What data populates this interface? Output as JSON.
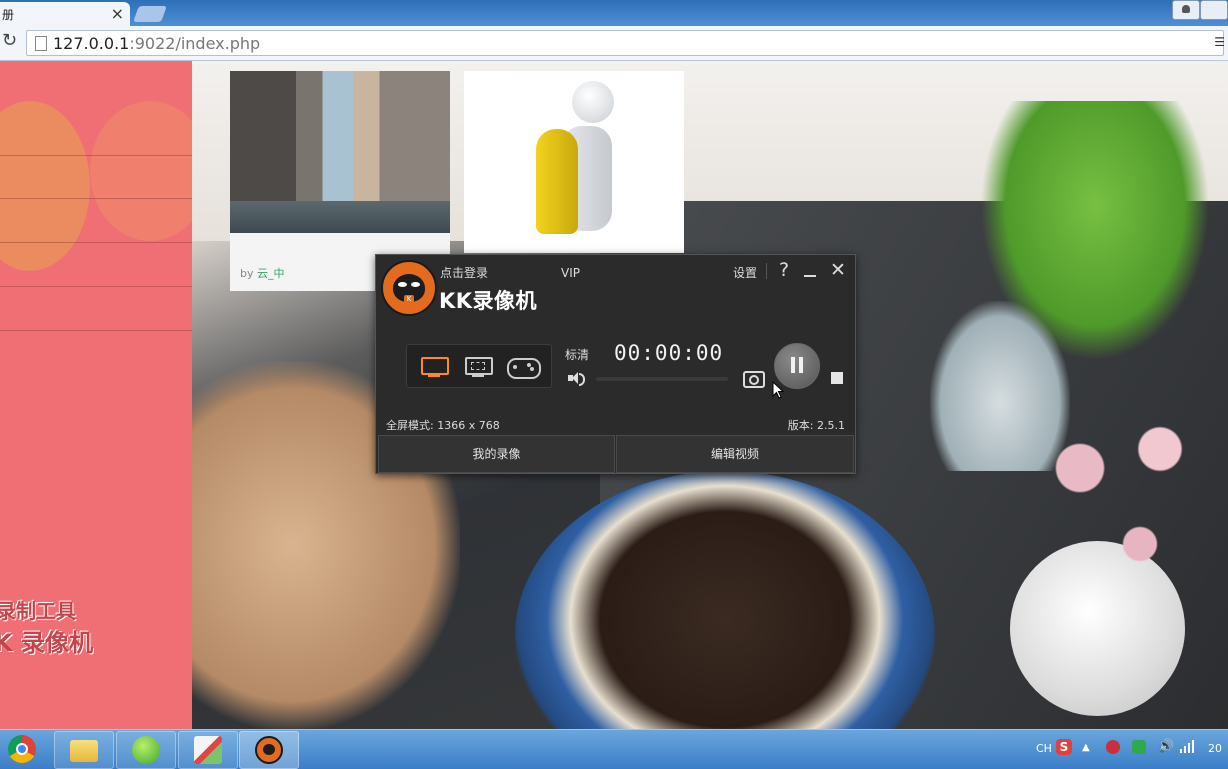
{
  "browser": {
    "tab_title": "册",
    "tab_close": "×",
    "address_host": "127.0.0.1",
    "address_rest": ":9022/index.php",
    "omnibox_end": "☰"
  },
  "page": {
    "card1_by_prefix": "by ",
    "card1_author": "云_中",
    "sidebar_overlay_line1": "录制工具",
    "sidebar_overlay_line2": "K 录像机"
  },
  "kk_recorder": {
    "login_label": "点击登录",
    "vip_label": "VIP",
    "title": "KK录像机",
    "settings_label": "设置",
    "help_label": "?",
    "close_label": "✕",
    "logo_badge": "K",
    "quality_label": "标清",
    "timer": "00:00:00",
    "status_left": "全屏模式: 1366 x 768",
    "status_right": "版本: 2.5.1",
    "my_recordings_button": "我的录像",
    "edit_video_button": "编辑视频",
    "active_mode": "fullscreen",
    "accent_color": "#ff8a1e"
  },
  "taskbar": {
    "items": [
      "chrome-icon",
      "folder-icon",
      "green-app-icon",
      "pen-app-icon",
      "kk-recorder-icon"
    ],
    "tray_lang": "CH",
    "tray_ime": "S",
    "tray_expand": "▲",
    "tray_volume": "🔊",
    "clock_partial": "20"
  }
}
